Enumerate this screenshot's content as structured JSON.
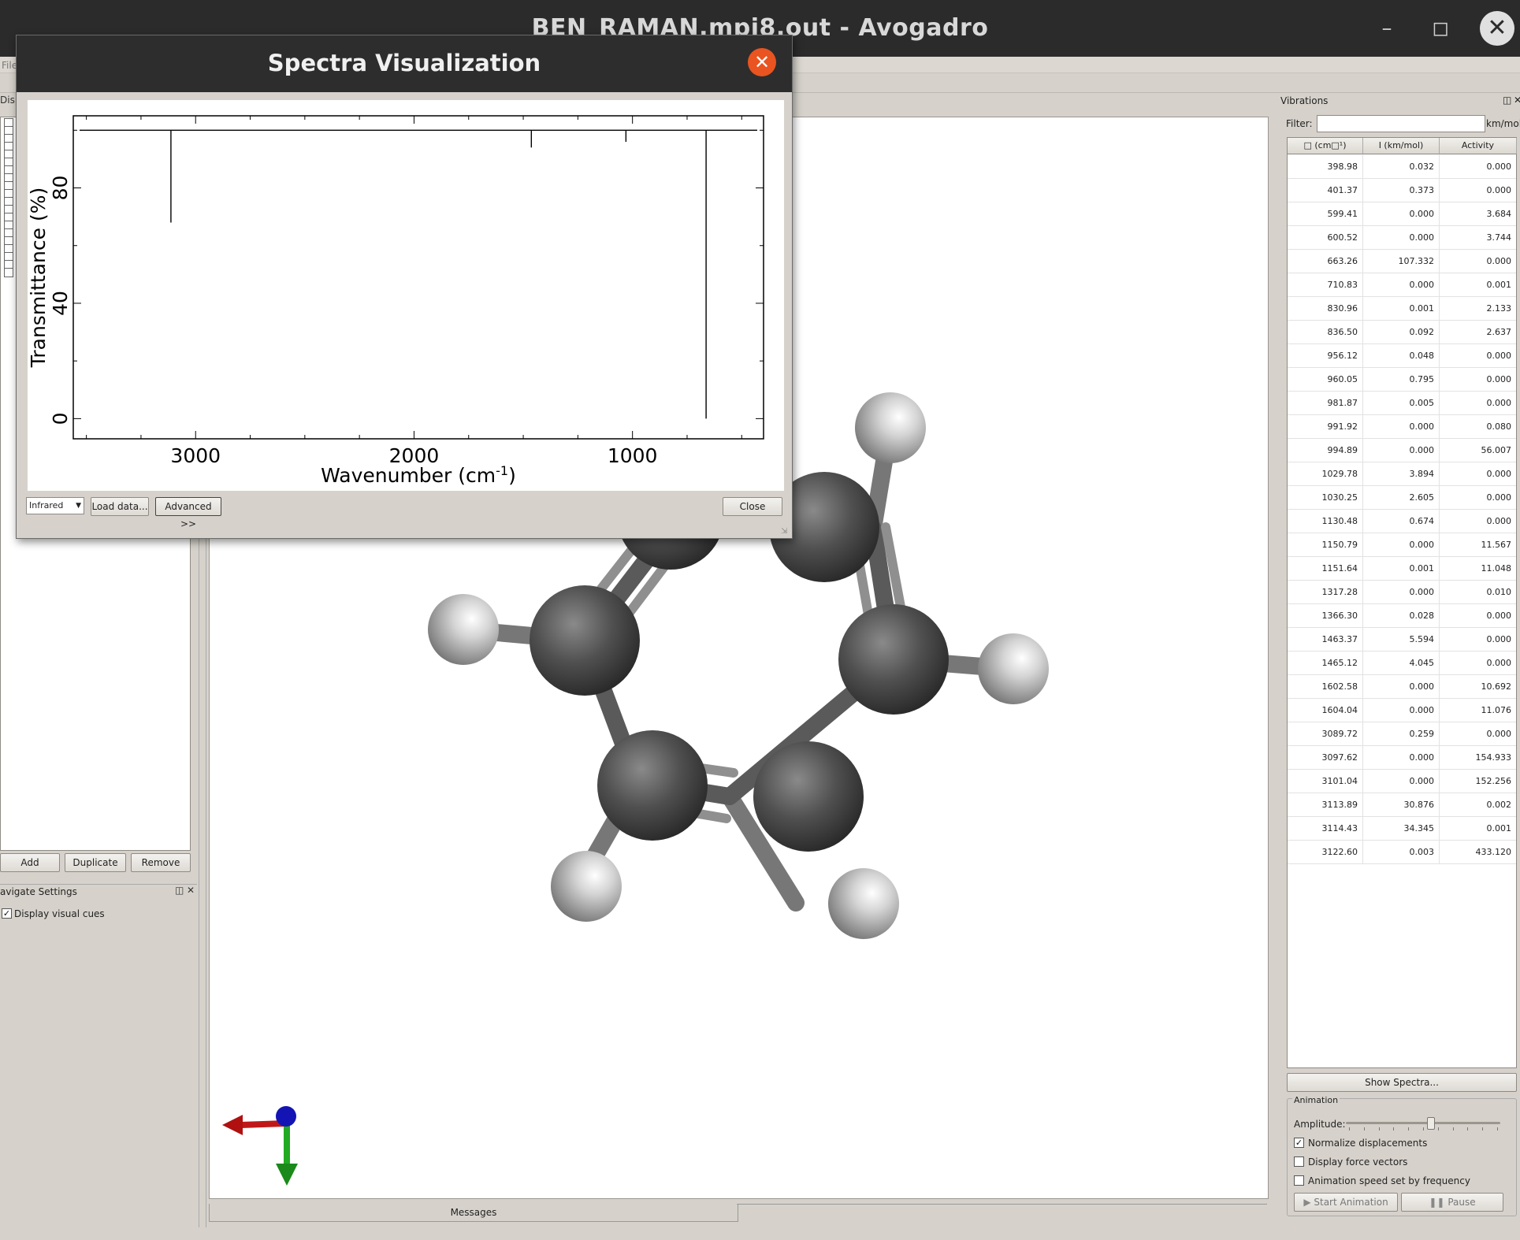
{
  "window": {
    "title": "BEN_RAMAN.mpi8.out - Avogadro"
  },
  "menubar": {
    "file_label": "File"
  },
  "left_dock": {
    "header_label": "Displa",
    "buttons": {
      "add": "Add",
      "duplicate": "Duplicate",
      "remove": "Remove"
    },
    "navigate_settings": {
      "title": "avigate Settings",
      "display_visual_cues": "Display visual cues"
    }
  },
  "dialog": {
    "title": "Spectra Visualization",
    "spectrum_type": "Infrared",
    "load_data_label": "Load data...",
    "advanced_label": "Advanced >>",
    "close_label": "Close"
  },
  "chart_data": {
    "type": "line",
    "xlabel": "Wavenumber (cm-1)",
    "ylabel": "Transmittance (%)",
    "xlim": [
      3560,
      400
    ],
    "ylim": [
      -7,
      105
    ],
    "x_ticks": [
      3000,
      2000,
      1000
    ],
    "y_ticks": [
      0,
      40,
      80
    ],
    "grid": false,
    "baseline": 100,
    "peaks": [
      {
        "x": 3113,
        "y": 68
      },
      {
        "x": 1463,
        "y": 94
      },
      {
        "x": 1030,
        "y": 96
      },
      {
        "x": 663,
        "y": 0
      }
    ]
  },
  "viewport": {
    "messages_tab": "Messages"
  },
  "vibrations": {
    "title": "Vibrations",
    "filter_label": "Filter:",
    "filter_value": "",
    "unit_label": "km/mol",
    "columns": [
      "□ (cm□¹)",
      "I (km/mol)",
      "Activity"
    ],
    "rows": [
      [
        "398.98",
        "0.032",
        "0.000"
      ],
      [
        "401.37",
        "0.373",
        "0.000"
      ],
      [
        "599.41",
        "0.000",
        "3.684"
      ],
      [
        "600.52",
        "0.000",
        "3.744"
      ],
      [
        "663.26",
        "107.332",
        "0.000"
      ],
      [
        "710.83",
        "0.000",
        "0.001"
      ],
      [
        "830.96",
        "0.001",
        "2.133"
      ],
      [
        "836.50",
        "0.092",
        "2.637"
      ],
      [
        "956.12",
        "0.048",
        "0.000"
      ],
      [
        "960.05",
        "0.795",
        "0.000"
      ],
      [
        "981.87",
        "0.005",
        "0.000"
      ],
      [
        "991.92",
        "0.000",
        "0.080"
      ],
      [
        "994.89",
        "0.000",
        "56.007"
      ],
      [
        "1029.78",
        "3.894",
        "0.000"
      ],
      [
        "1030.25",
        "2.605",
        "0.000"
      ],
      [
        "1130.48",
        "0.674",
        "0.000"
      ],
      [
        "1150.79",
        "0.000",
        "11.567"
      ],
      [
        "1151.64",
        "0.001",
        "11.048"
      ],
      [
        "1317.28",
        "0.000",
        "0.010"
      ],
      [
        "1366.30",
        "0.028",
        "0.000"
      ],
      [
        "1463.37",
        "5.594",
        "0.000"
      ],
      [
        "1465.12",
        "4.045",
        "0.000"
      ],
      [
        "1602.58",
        "0.000",
        "10.692"
      ],
      [
        "1604.04",
        "0.000",
        "11.076"
      ],
      [
        "3089.72",
        "0.259",
        "0.000"
      ],
      [
        "3097.62",
        "0.000",
        "154.933"
      ],
      [
        "3101.04",
        "0.000",
        "152.256"
      ],
      [
        "3113.89",
        "30.876",
        "0.002"
      ],
      [
        "3114.43",
        "34.345",
        "0.001"
      ],
      [
        "3122.60",
        "0.003",
        "433.120"
      ]
    ],
    "show_spectra_label": "Show Spectra...",
    "animation": {
      "group_title": "Animation",
      "amplitude_label": "Amplitude:",
      "amplitude_level": 0.55,
      "normalize_label": "Normalize displacements",
      "normalize_checked": true,
      "force_vectors_label": "Display force vectors",
      "speed_label": "Animation speed set by frequency",
      "start_label": "Start Animation",
      "pause_label": "Pause"
    }
  }
}
